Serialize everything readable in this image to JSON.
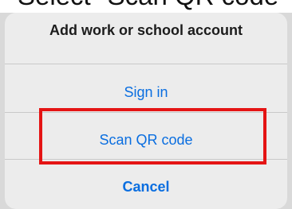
{
  "caption": "Select \"Scan QR code\"",
  "sheet": {
    "title": "Add work or school account",
    "actions": {
      "sign_in": "Sign in",
      "scan_qr": "Scan QR code",
      "cancel": "Cancel"
    }
  },
  "colors": {
    "accent": "#0a6ee0",
    "highlight": "#e41414",
    "sheet_bg": "#ececec"
  }
}
